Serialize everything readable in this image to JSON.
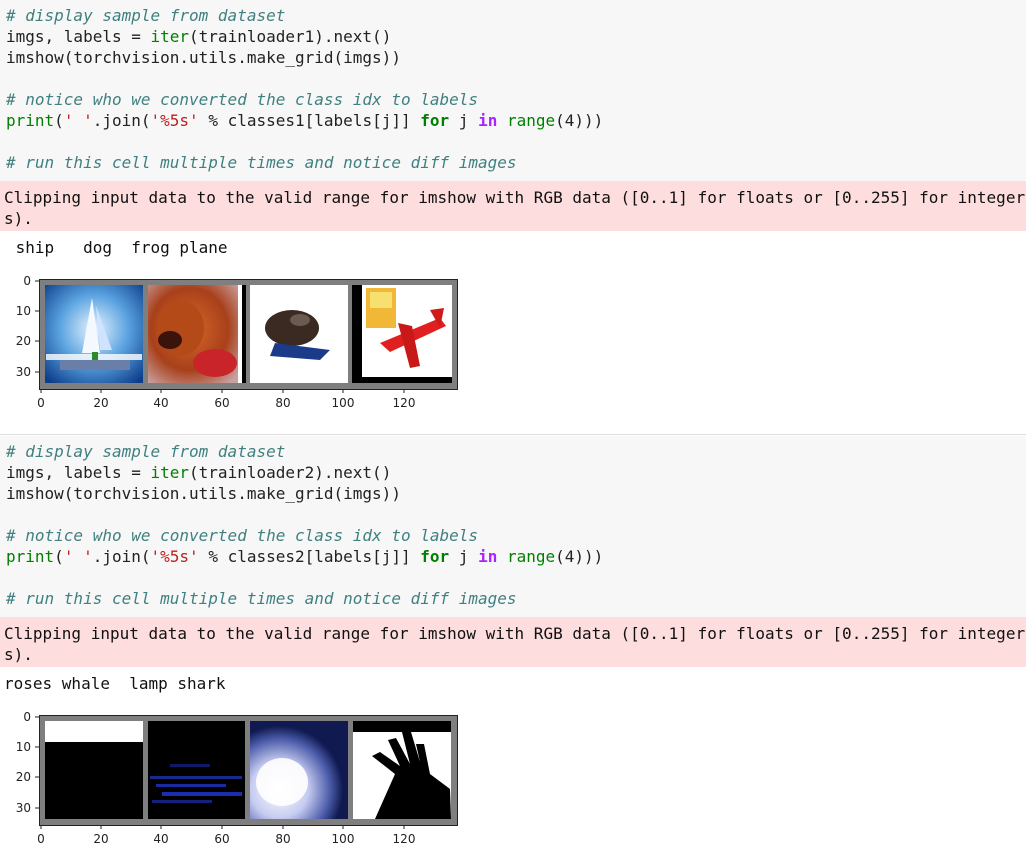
{
  "cells": [
    {
      "code": {
        "comment1": "# display sample from dataset",
        "line2_pre": "imgs, labels = ",
        "line2_fn": "iter",
        "line2_post": "(trainloader1).next()",
        "line3": "imshow(torchvision.utils.make_grid(imgs))",
        "comment2": "# notice who we converted the class idx to labels",
        "print_fn": "print",
        "print_a": "(",
        "print_str1": "' '",
        "print_b": ".join(",
        "print_str2": "'%5s'",
        "print_c": " % classes1[labels[j]] ",
        "kw_for": "for",
        "print_d": " j ",
        "kw_in": "in",
        "print_e": " ",
        "fn_range": "range",
        "print_f": "(4)))",
        "comment3": "# run this cell multiple times and notice diff images"
      },
      "stderr": "Clipping input data to the valid range for imshow with RGB data ([0..1] for floats or [0..255] for integer\ns).",
      "stdout": " ship   dog  frog plane",
      "plot": {
        "x_ticks": [
          "0",
          "20",
          "40",
          "60",
          "80",
          "100",
          "120"
        ],
        "y_ticks": [
          "0",
          "10",
          "20",
          "30"
        ],
        "images": [
          "ship",
          "dog",
          "frog",
          "plane"
        ]
      }
    },
    {
      "code": {
        "comment1": "# display sample from dataset",
        "line2_pre": "imgs, labels = ",
        "line2_fn": "iter",
        "line2_post": "(trainloader2).next()",
        "line3": "imshow(torchvision.utils.make_grid(imgs))",
        "comment2": "# notice who we converted the class idx to labels",
        "print_fn": "print",
        "print_a": "(",
        "print_str1": "' '",
        "print_b": ".join(",
        "print_str2": "'%5s'",
        "print_c": " % classes2[labels[j]] ",
        "kw_for": "for",
        "print_d": " j ",
        "kw_in": "in",
        "print_e": " ",
        "fn_range": "range",
        "print_f": "(4)))",
        "comment3": "# run this cell multiple times and notice diff images"
      },
      "stderr": "Clipping input data to the valid range for imshow with RGB data ([0..1] for floats or [0..255] for integer\ns).",
      "stdout": "roses whale  lamp shark",
      "plot": {
        "x_ticks": [
          "0",
          "20",
          "40",
          "60",
          "80",
          "100",
          "120"
        ],
        "y_ticks": [
          "0",
          "10",
          "20",
          "30"
        ],
        "images": [
          "roses",
          "whale",
          "lamp",
          "shark"
        ]
      }
    }
  ]
}
